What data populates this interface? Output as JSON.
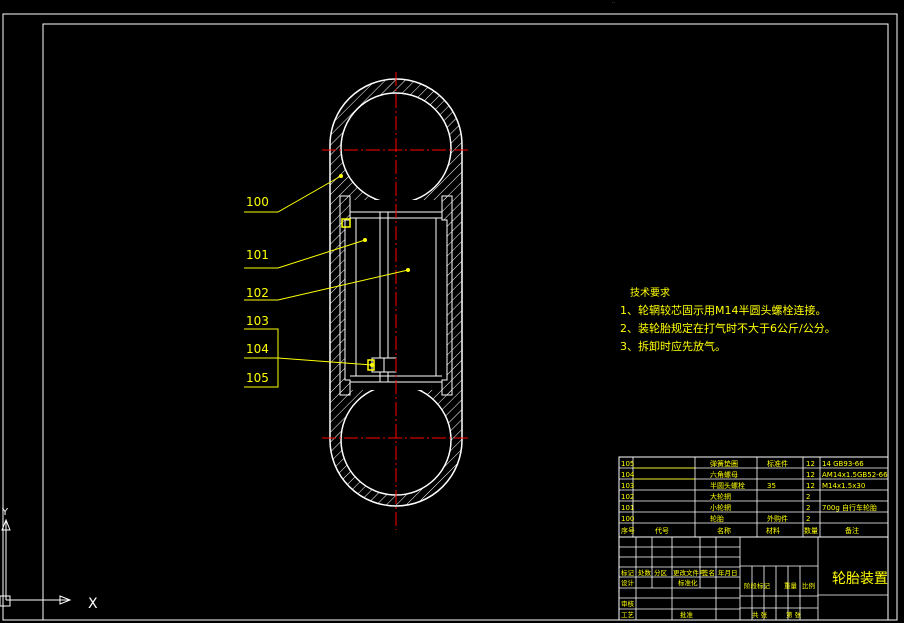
{
  "drawing": {
    "part_labels": [
      "100",
      "101",
      "102",
      "103",
      "104",
      "105"
    ],
    "tech_requirements": {
      "title": "技术要求",
      "items": [
        "1、轮辋较芯固示用M14半圆头螺栓连接。",
        "2、装轮胎规定在打气时不大于6公斤/公分。",
        "3、拆卸时应先放气。"
      ]
    },
    "parts_list": {
      "rows": [
        {
          "no": "105",
          "code": "",
          "name": "弹簧垫圈",
          "qty": "12",
          "material": "标准件",
          "note": "14 GB93-66"
        },
        {
          "no": "104",
          "code": "",
          "name": "六角螺母",
          "qty": "12",
          "material": "",
          "note": "AM14x1.5GB52-66"
        },
        {
          "no": "103",
          "code": "",
          "name": "半圆头螺栓",
          "qty": "12",
          "material": "35",
          "note": "M14x1.5x30"
        },
        {
          "no": "102",
          "code": "",
          "name": "大轮辋",
          "qty": "2",
          "material": "",
          "note": ""
        },
        {
          "no": "101",
          "code": "",
          "name": "小轮辋",
          "qty": "2",
          "material": "",
          "note": "700g 自行车轮胎"
        },
        {
          "no": "100",
          "code": "",
          "name": "轮胎",
          "qty": "2",
          "material": "外购件",
          "note": ""
        }
      ],
      "header": {
        "no": "序号",
        "code": "代号",
        "name": "名称",
        "qty": "数量",
        "material": "材料",
        "note": "备注"
      }
    },
    "title_block": {
      "title": "轮胎装置",
      "row_marks": [
        "标记",
        "处数",
        "分区",
        "更改文件号",
        "签名",
        "年月日"
      ],
      "design": "设计",
      "standardize": "标准化",
      "stage_mark": "阶段标记",
      "weight": "重量",
      "scale": "比例",
      "review": "审核",
      "process": "工艺",
      "approve": "批准",
      "sheets_total": "共 张",
      "sheet_no": "第 张"
    },
    "ucs": {
      "x_label": "X",
      "y_label": "Y"
    }
  },
  "colors": {
    "background": "#000000",
    "line_white": "#ffffff",
    "line_yellow": "#ffff00",
    "centerline_red": "#ff0000",
    "hatch": "#ffffff"
  }
}
